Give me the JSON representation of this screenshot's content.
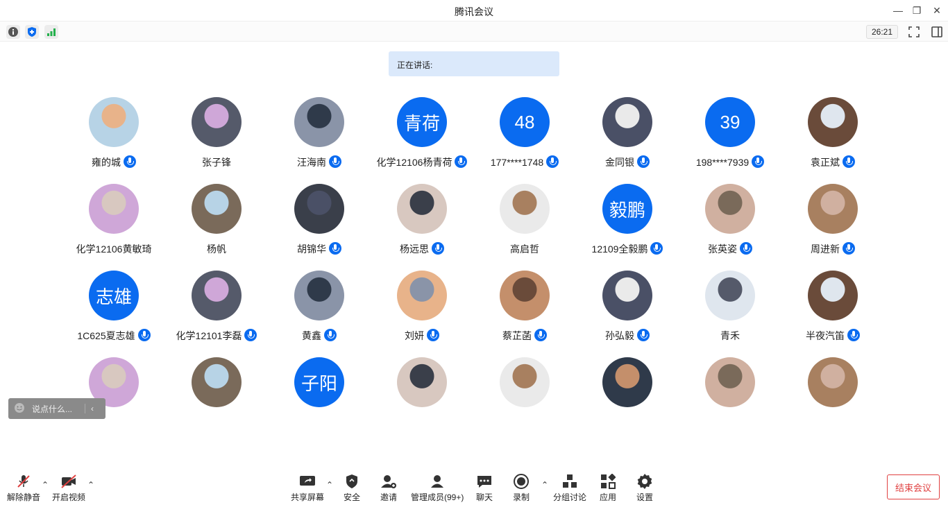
{
  "window": {
    "title": "腾讯会议"
  },
  "toolbar": {
    "timer": "26:21"
  },
  "speaking": {
    "label": "正在讲话:"
  },
  "participants": [
    {
      "name": "雍的城",
      "avatar": "img",
      "mic": true
    },
    {
      "name": "张子锋",
      "avatar": "img",
      "mic": false
    },
    {
      "name": "汪海南",
      "avatar": "img",
      "mic": true
    },
    {
      "name": "化学12106杨青荷",
      "avatar": "青荷",
      "mic": true
    },
    {
      "name": "177****1748",
      "avatar": "48",
      "mic": true
    },
    {
      "name": "金同银",
      "avatar": "img",
      "mic": true
    },
    {
      "name": "198****7939",
      "avatar": "39",
      "mic": true
    },
    {
      "name": "袁正斌",
      "avatar": "img",
      "mic": true
    },
    {
      "name": "化学12106黄敏琦",
      "avatar": "img",
      "mic": false
    },
    {
      "name": "杨帆",
      "avatar": "img",
      "mic": false
    },
    {
      "name": "胡锦华",
      "avatar": "img",
      "mic": true
    },
    {
      "name": "杨远思",
      "avatar": "img",
      "mic": true
    },
    {
      "name": "高启哲",
      "avatar": "img",
      "mic": false
    },
    {
      "name": "12109全毅鹏",
      "avatar": "毅鹏",
      "mic": true
    },
    {
      "name": "张英姿",
      "avatar": "img",
      "mic": true
    },
    {
      "name": "周进新",
      "avatar": "img",
      "mic": true
    },
    {
      "name": "1C625夏志雄",
      "avatar": "志雄",
      "mic": true
    },
    {
      "name": "化学12101李磊",
      "avatar": "img",
      "mic": true
    },
    {
      "name": "黄鑫",
      "avatar": "img",
      "mic": true
    },
    {
      "name": "刘妍",
      "avatar": "img",
      "mic": true
    },
    {
      "name": "蔡芷菡",
      "avatar": "img",
      "mic": true
    },
    {
      "name": "孙弘毅",
      "avatar": "img",
      "mic": true
    },
    {
      "name": "青禾",
      "avatar": "img",
      "mic": false
    },
    {
      "name": "半夜汽笛",
      "avatar": "img",
      "mic": true
    },
    {
      "name": "",
      "avatar": "img",
      "mic": false
    },
    {
      "name": "",
      "avatar": "img",
      "mic": false
    },
    {
      "name": "",
      "avatar": "子阳",
      "mic": false
    },
    {
      "name": "",
      "avatar": "img",
      "mic": false
    },
    {
      "name": "",
      "avatar": "img",
      "mic": false
    },
    {
      "name": "",
      "avatar": "img",
      "mic": false
    },
    {
      "name": "",
      "avatar": "img",
      "mic": false
    },
    {
      "name": "",
      "avatar": "img",
      "mic": false
    }
  ],
  "chat": {
    "placeholder": "说点什么..."
  },
  "bottom": {
    "unmute": "解除静音",
    "video": "开启视频",
    "share": "共享屏幕",
    "security": "安全",
    "invite": "邀请",
    "members": "管理成员(99+)",
    "chat": "聊天",
    "record": "录制",
    "breakout": "分组讨论",
    "apps": "应用",
    "settings": "设置",
    "end": "结束会议"
  },
  "colors": {
    "accent": "#0a6bf0",
    "end": "#e04040",
    "speaking_bg": "#dbe9fb"
  }
}
